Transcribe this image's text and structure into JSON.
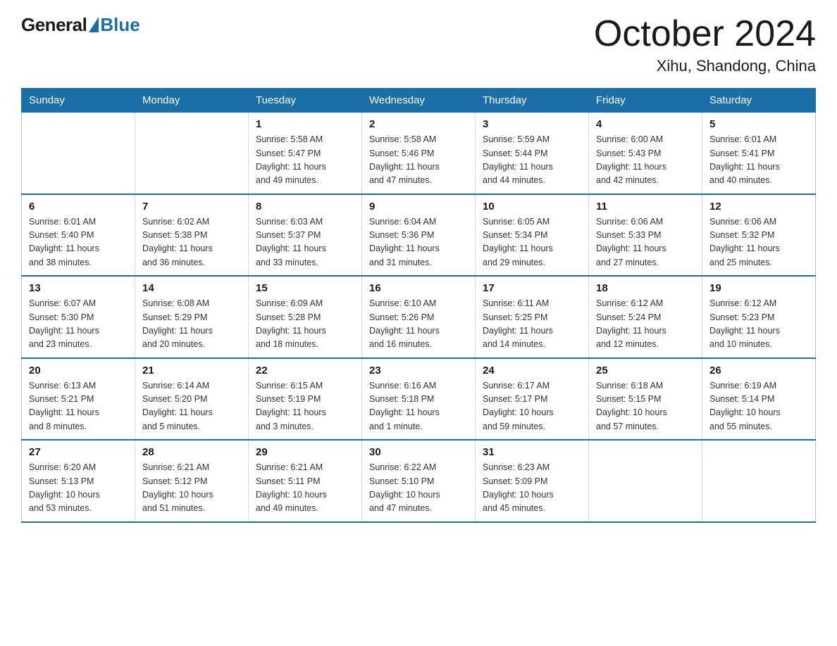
{
  "logo": {
    "general": "General",
    "blue": "Blue"
  },
  "title": {
    "month": "October 2024",
    "location": "Xihu, Shandong, China"
  },
  "weekdays": [
    "Sunday",
    "Monday",
    "Tuesday",
    "Wednesday",
    "Thursday",
    "Friday",
    "Saturday"
  ],
  "weeks": [
    [
      {
        "day": "",
        "info": ""
      },
      {
        "day": "",
        "info": ""
      },
      {
        "day": "1",
        "info": "Sunrise: 5:58 AM\nSunset: 5:47 PM\nDaylight: 11 hours\nand 49 minutes."
      },
      {
        "day": "2",
        "info": "Sunrise: 5:58 AM\nSunset: 5:46 PM\nDaylight: 11 hours\nand 47 minutes."
      },
      {
        "day": "3",
        "info": "Sunrise: 5:59 AM\nSunset: 5:44 PM\nDaylight: 11 hours\nand 44 minutes."
      },
      {
        "day": "4",
        "info": "Sunrise: 6:00 AM\nSunset: 5:43 PM\nDaylight: 11 hours\nand 42 minutes."
      },
      {
        "day": "5",
        "info": "Sunrise: 6:01 AM\nSunset: 5:41 PM\nDaylight: 11 hours\nand 40 minutes."
      }
    ],
    [
      {
        "day": "6",
        "info": "Sunrise: 6:01 AM\nSunset: 5:40 PM\nDaylight: 11 hours\nand 38 minutes."
      },
      {
        "day": "7",
        "info": "Sunrise: 6:02 AM\nSunset: 5:38 PM\nDaylight: 11 hours\nand 36 minutes."
      },
      {
        "day": "8",
        "info": "Sunrise: 6:03 AM\nSunset: 5:37 PM\nDaylight: 11 hours\nand 33 minutes."
      },
      {
        "day": "9",
        "info": "Sunrise: 6:04 AM\nSunset: 5:36 PM\nDaylight: 11 hours\nand 31 minutes."
      },
      {
        "day": "10",
        "info": "Sunrise: 6:05 AM\nSunset: 5:34 PM\nDaylight: 11 hours\nand 29 minutes."
      },
      {
        "day": "11",
        "info": "Sunrise: 6:06 AM\nSunset: 5:33 PM\nDaylight: 11 hours\nand 27 minutes."
      },
      {
        "day": "12",
        "info": "Sunrise: 6:06 AM\nSunset: 5:32 PM\nDaylight: 11 hours\nand 25 minutes."
      }
    ],
    [
      {
        "day": "13",
        "info": "Sunrise: 6:07 AM\nSunset: 5:30 PM\nDaylight: 11 hours\nand 23 minutes."
      },
      {
        "day": "14",
        "info": "Sunrise: 6:08 AM\nSunset: 5:29 PM\nDaylight: 11 hours\nand 20 minutes."
      },
      {
        "day": "15",
        "info": "Sunrise: 6:09 AM\nSunset: 5:28 PM\nDaylight: 11 hours\nand 18 minutes."
      },
      {
        "day": "16",
        "info": "Sunrise: 6:10 AM\nSunset: 5:26 PM\nDaylight: 11 hours\nand 16 minutes."
      },
      {
        "day": "17",
        "info": "Sunrise: 6:11 AM\nSunset: 5:25 PM\nDaylight: 11 hours\nand 14 minutes."
      },
      {
        "day": "18",
        "info": "Sunrise: 6:12 AM\nSunset: 5:24 PM\nDaylight: 11 hours\nand 12 minutes."
      },
      {
        "day": "19",
        "info": "Sunrise: 6:12 AM\nSunset: 5:23 PM\nDaylight: 11 hours\nand 10 minutes."
      }
    ],
    [
      {
        "day": "20",
        "info": "Sunrise: 6:13 AM\nSunset: 5:21 PM\nDaylight: 11 hours\nand 8 minutes."
      },
      {
        "day": "21",
        "info": "Sunrise: 6:14 AM\nSunset: 5:20 PM\nDaylight: 11 hours\nand 5 minutes."
      },
      {
        "day": "22",
        "info": "Sunrise: 6:15 AM\nSunset: 5:19 PM\nDaylight: 11 hours\nand 3 minutes."
      },
      {
        "day": "23",
        "info": "Sunrise: 6:16 AM\nSunset: 5:18 PM\nDaylight: 11 hours\nand 1 minute."
      },
      {
        "day": "24",
        "info": "Sunrise: 6:17 AM\nSunset: 5:17 PM\nDaylight: 10 hours\nand 59 minutes."
      },
      {
        "day": "25",
        "info": "Sunrise: 6:18 AM\nSunset: 5:15 PM\nDaylight: 10 hours\nand 57 minutes."
      },
      {
        "day": "26",
        "info": "Sunrise: 6:19 AM\nSunset: 5:14 PM\nDaylight: 10 hours\nand 55 minutes."
      }
    ],
    [
      {
        "day": "27",
        "info": "Sunrise: 6:20 AM\nSunset: 5:13 PM\nDaylight: 10 hours\nand 53 minutes."
      },
      {
        "day": "28",
        "info": "Sunrise: 6:21 AM\nSunset: 5:12 PM\nDaylight: 10 hours\nand 51 minutes."
      },
      {
        "day": "29",
        "info": "Sunrise: 6:21 AM\nSunset: 5:11 PM\nDaylight: 10 hours\nand 49 minutes."
      },
      {
        "day": "30",
        "info": "Sunrise: 6:22 AM\nSunset: 5:10 PM\nDaylight: 10 hours\nand 47 minutes."
      },
      {
        "day": "31",
        "info": "Sunrise: 6:23 AM\nSunset: 5:09 PM\nDaylight: 10 hours\nand 45 minutes."
      },
      {
        "day": "",
        "info": ""
      },
      {
        "day": "",
        "info": ""
      }
    ]
  ]
}
